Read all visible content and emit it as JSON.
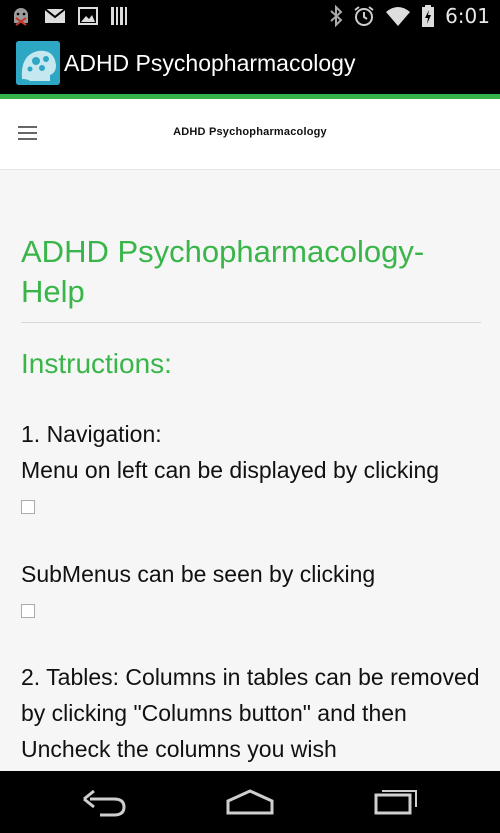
{
  "status_bar": {
    "time": "6:01"
  },
  "action_bar": {
    "title": "ADHD Psychopharmacology"
  },
  "web_header": {
    "title": "ADHD Psychopharmacology"
  },
  "content": {
    "heading": "ADHD Psychopharmacology-Help",
    "subheading": "Instructions:",
    "nav_heading": "1. Navigation:",
    "nav_text": "Menu on left can be displayed by clicking",
    "submenu_text": "SubMenus can be seen by clicking",
    "tables_text": "2. Tables: Columns in tables can be removed by clicking \"Columns button\" and then Uncheck the columns you wish"
  },
  "colors": {
    "accent": "#39b54a",
    "status_bar": "#000000"
  }
}
